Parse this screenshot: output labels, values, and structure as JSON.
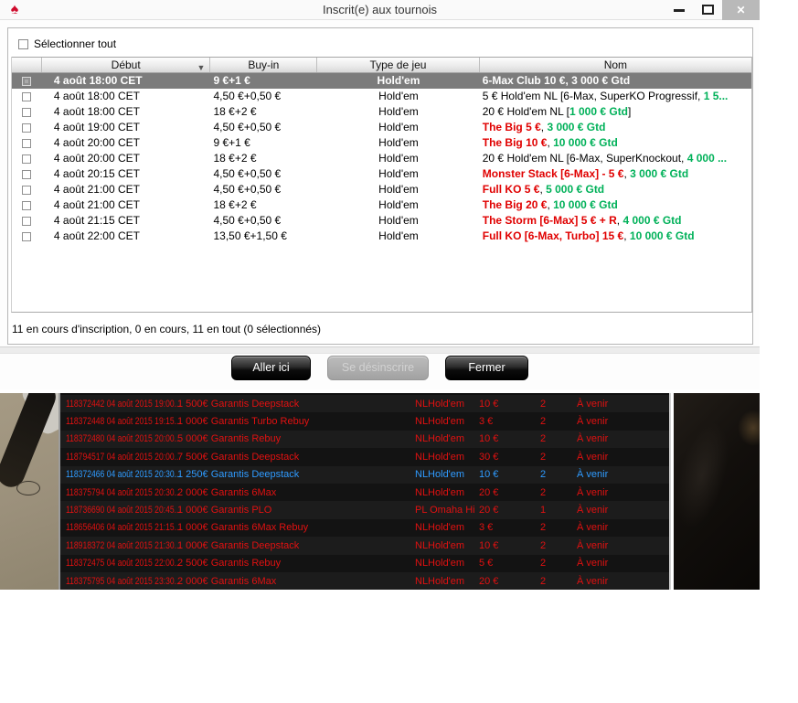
{
  "window": {
    "title": "Inscrit(e) aux tournois"
  },
  "icons": {
    "spade": "♠",
    "star": "★",
    "sort_desc": "▼",
    "close": "✕"
  },
  "colors": {
    "accent_red": "#e00000",
    "accent_green": "#00b159",
    "highlight_blue": "#2f9bff",
    "selected_row_bg": "#7c7c7c",
    "lobby_bg": "#141414"
  },
  "dialog": {
    "select_all_label": "Sélectionner tout",
    "status": "11 en cours d'inscription, 0 en cours, 11 en tout (0 sélectionnés)",
    "buttons": [
      {
        "label": "Aller ici",
        "enabled": true
      },
      {
        "label": "Se désinscrire",
        "enabled": false
      },
      {
        "label": "Fermer",
        "enabled": true
      }
    ],
    "table": {
      "columns": {
        "start": "Début",
        "buyin": "Buy-in",
        "game": "Type de jeu",
        "name": "Nom"
      },
      "sorted_by": "Début",
      "rows": [
        {
          "selected": true,
          "start": "4 août 18:00 CET",
          "buyin": "9 €+1 €",
          "game": "Hold'em",
          "name": [
            {
              "text": "6-Max Club 10 €, 3 000 € Gtd",
              "style": "b"
            }
          ]
        },
        {
          "selected": false,
          "start": "4 août 18:00 CET",
          "buyin": "4,50 €+0,50 €",
          "game": "Hold'em",
          "name": [
            {
              "text": "5 € Hold'em NL [6-Max, SuperKO Progressif, ",
              "style": "plain"
            },
            {
              "text": "1 5...",
              "style": "green"
            }
          ]
        },
        {
          "selected": false,
          "start": "4 août 18:00 CET",
          "buyin": "18 €+2 €",
          "game": "Hold'em",
          "name": [
            {
              "text": "20 € Hold'em NL [",
              "style": "plain"
            },
            {
              "text": "1 000 € Gtd",
              "style": "green"
            },
            {
              "text": "]",
              "style": "plain"
            }
          ]
        },
        {
          "selected": false,
          "start": "4 août 19:00 CET",
          "buyin": "4,50 €+0,50 €",
          "game": "Hold'em",
          "name": [
            {
              "text": "The Big 5 €",
              "style": "red"
            },
            {
              "text": ", ",
              "style": "plain"
            },
            {
              "text": "3 000 € Gtd",
              "style": "green"
            }
          ]
        },
        {
          "selected": false,
          "start": "4 août 20:00 CET",
          "buyin": "9 €+1 €",
          "game": "Hold'em",
          "name": [
            {
              "text": "The Big 10 €",
              "style": "red"
            },
            {
              "text": ", ",
              "style": "plain"
            },
            {
              "text": "10 000 € Gtd",
              "style": "green"
            }
          ]
        },
        {
          "selected": false,
          "start": "4 août 20:00 CET",
          "buyin": "18 €+2 €",
          "game": "Hold'em",
          "name": [
            {
              "text": "20 € Hold'em NL [6-Max, SuperKnockout, ",
              "style": "plain"
            },
            {
              "text": "4 000 ...",
              "style": "green"
            }
          ]
        },
        {
          "selected": false,
          "start": "4 août 20:15 CET",
          "buyin": "4,50 €+0,50 €",
          "game": "Hold'em",
          "name": [
            {
              "text": "Monster Stack [6-Max] - 5 €",
              "style": "red"
            },
            {
              "text": ", ",
              "style": "plain"
            },
            {
              "text": "3 000 € Gtd",
              "style": "green"
            }
          ]
        },
        {
          "selected": false,
          "start": "4 août 21:00 CET",
          "buyin": "4,50 €+0,50 €",
          "game": "Hold'em",
          "name": [
            {
              "text": "Full KO 5 €",
              "style": "red"
            },
            {
              "text": ", ",
              "style": "plain"
            },
            {
              "text": "5 000 € Gtd",
              "style": "green"
            }
          ]
        },
        {
          "selected": false,
          "start": "4 août 21:00 CET",
          "buyin": "18 €+2 €",
          "game": "Hold'em",
          "name": [
            {
              "text": "The Big 20 €",
              "style": "red"
            },
            {
              "text": ", ",
              "style": "plain"
            },
            {
              "text": "10 000 € Gtd",
              "style": "green"
            }
          ]
        },
        {
          "selected": false,
          "start": "4 août 21:15 CET",
          "buyin": "4,50 €+0,50 €",
          "game": "Hold'em",
          "name": [
            {
              "text": "The Storm [6-Max] 5 € + R",
              "style": "red"
            },
            {
              "text": ", ",
              "style": "plain"
            },
            {
              "text": "4 000 € Gtd",
              "style": "green"
            }
          ]
        },
        {
          "selected": false,
          "start": "4 août 22:00 CET",
          "buyin": "13,50 €+1,50 €",
          "game": "Hold'em",
          "name": [
            {
              "text": "Full KO [6-Max, Turbo] 15 €",
              "style": "red"
            },
            {
              "text": ", ",
              "style": "plain"
            },
            {
              "text": "10 000 € Gtd",
              "style": "green"
            }
          ]
        }
      ]
    }
  },
  "lobby_table": {
    "rows": [
      {
        "id_date": "118372442 04 août 2015 19:00...",
        "name": "1 500€ Garantis Deepstack",
        "game": "NLHold'em",
        "buyin": "10 €",
        "tables": "2",
        "status": "À venir",
        "highlight": false
      },
      {
        "id_date": "118372448 04 août 2015 19:15...",
        "name": "1 000€ Garantis Turbo Rebuy",
        "game": "NLHold'em",
        "buyin": "3 €",
        "tables": "2",
        "status": "À venir",
        "highlight": false
      },
      {
        "id_date": "118372480 04 août 2015 20:00...",
        "name": "5 000€ Garantis Rebuy",
        "game": "NLHold'em",
        "buyin": "10 €",
        "tables": "2",
        "status": "À venir",
        "highlight": false
      },
      {
        "id_date": "118794517 04 août 2015 20:00...",
        "name": "7 500€ Garantis Deepstack",
        "game": "NLHold'em",
        "buyin": "30 €",
        "tables": "2",
        "status": "À venir",
        "highlight": false
      },
      {
        "id_date": "118372466 04 août 2015 20:30...",
        "name": "1 250€ Garantis Deepstack",
        "game": "NLHold'em",
        "buyin": "10 €",
        "tables": "2",
        "status": "À venir",
        "highlight": true
      },
      {
        "id_date": "118375794 04 août 2015 20:30...",
        "name": "2 000€ Garantis 6Max",
        "game": "NLHold'em",
        "buyin": "20 €",
        "tables": "2",
        "status": "À venir",
        "highlight": false
      },
      {
        "id_date": "118736690 04 août 2015 20:45...",
        "name": "1 000€ Garantis PLO",
        "game": "PL Omaha Hi",
        "buyin": "20 €",
        "tables": "1",
        "status": "À venir",
        "highlight": false
      },
      {
        "id_date": "118656406 04 août 2015 21:15...",
        "name": "1 000€ Garantis 6Max Rebuy",
        "game": "NLHold'em",
        "buyin": "3 €",
        "tables": "2",
        "status": "À venir",
        "highlight": false
      },
      {
        "id_date": "118918372 04 août 2015 21:30...",
        "name": "1 000€ Garantis Deepstack",
        "game": "NLHold'em",
        "buyin": "10 €",
        "tables": "2",
        "status": "À venir",
        "highlight": false
      },
      {
        "id_date": "118372475 04 août 2015 22:00...",
        "name": "2 500€ Garantis Rebuy",
        "game": "NLHold'em",
        "buyin": "5 €",
        "tables": "2",
        "status": "À venir",
        "highlight": false
      },
      {
        "id_date": "118375795 04 août 2015 23:30...",
        "name": "2 000€ Garantis 6Max",
        "game": "NLHold'em",
        "buyin": "20 €",
        "tables": "2",
        "status": "À venir",
        "highlight": false
      }
    ]
  }
}
